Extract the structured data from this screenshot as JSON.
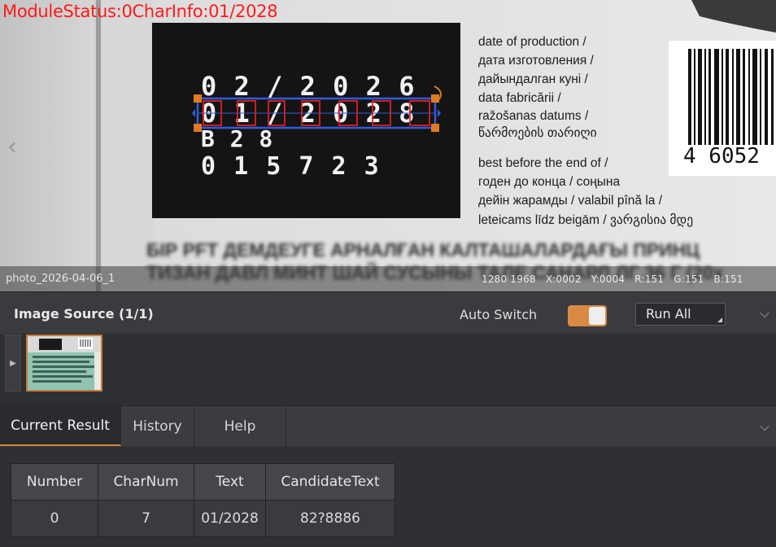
{
  "viewer": {
    "status_overlay": "ModuleStatus:0CharInfo:01/2028",
    "image_name": "photo_2026-04-06_1",
    "pixel_info": [
      "1280 1968",
      "X:0002",
      "Y:0004",
      "R:151",
      "G:151",
      "B:151"
    ],
    "photo": {
      "label_rows": [
        "0 2 / 2 0 2 6",
        "0 1 / 2 0 2 8",
        "B       2 8",
        "0 1 5 7 2 3"
      ],
      "production_text": [
        "date of production /",
        "дата изготовления /",
        "дайындалган куні /",
        "data fabricării /",
        "ražošanas datums /",
        "წარმოების თარიღი"
      ],
      "best_before_text": [
        "best before the end of /",
        "годен до конца / соңына",
        "дейін жарамды / valabil pînă la /",
        "leteicams līdz beigām / ვარგისია მდე"
      ],
      "blurred_text": [
        "БІР PFT ДЕМДЕУГЕ АРНАЛҒАН КАЛТАШАЛАРДАҒЫ ПРИНЦ",
        "ТИЗАН ДАВЛ МИНТ ШАЙ СУСЫНЫ ТАЛЕ САНАРЛ ЛГ 36 Г (20x"
      ],
      "barcode_digits": "4 6052"
    }
  },
  "source": {
    "title": "Image Source (1/1)",
    "auto_switch_label": "Auto Switch",
    "auto_switch_on": true,
    "run_all_label": "Run All"
  },
  "tabs": [
    {
      "label": "Current Result",
      "active": true
    },
    {
      "label": "History",
      "active": false
    },
    {
      "label": "Help",
      "active": false
    }
  ],
  "results": {
    "headers": [
      "Number",
      "CharNum",
      "Text",
      "CandidateText"
    ],
    "rows": [
      [
        "0",
        "7",
        "01/2028",
        "82?8886"
      ]
    ]
  },
  "icons": {
    "prev": "chevron-left-icon",
    "collapse": "chevron-down-icon",
    "strip": "triangle-right-icon"
  },
  "colors": {
    "overlay_text": "#ff1a1a",
    "accent": "#d9843d",
    "roi_box": "#2f5de0",
    "handles": "#e07a22"
  }
}
